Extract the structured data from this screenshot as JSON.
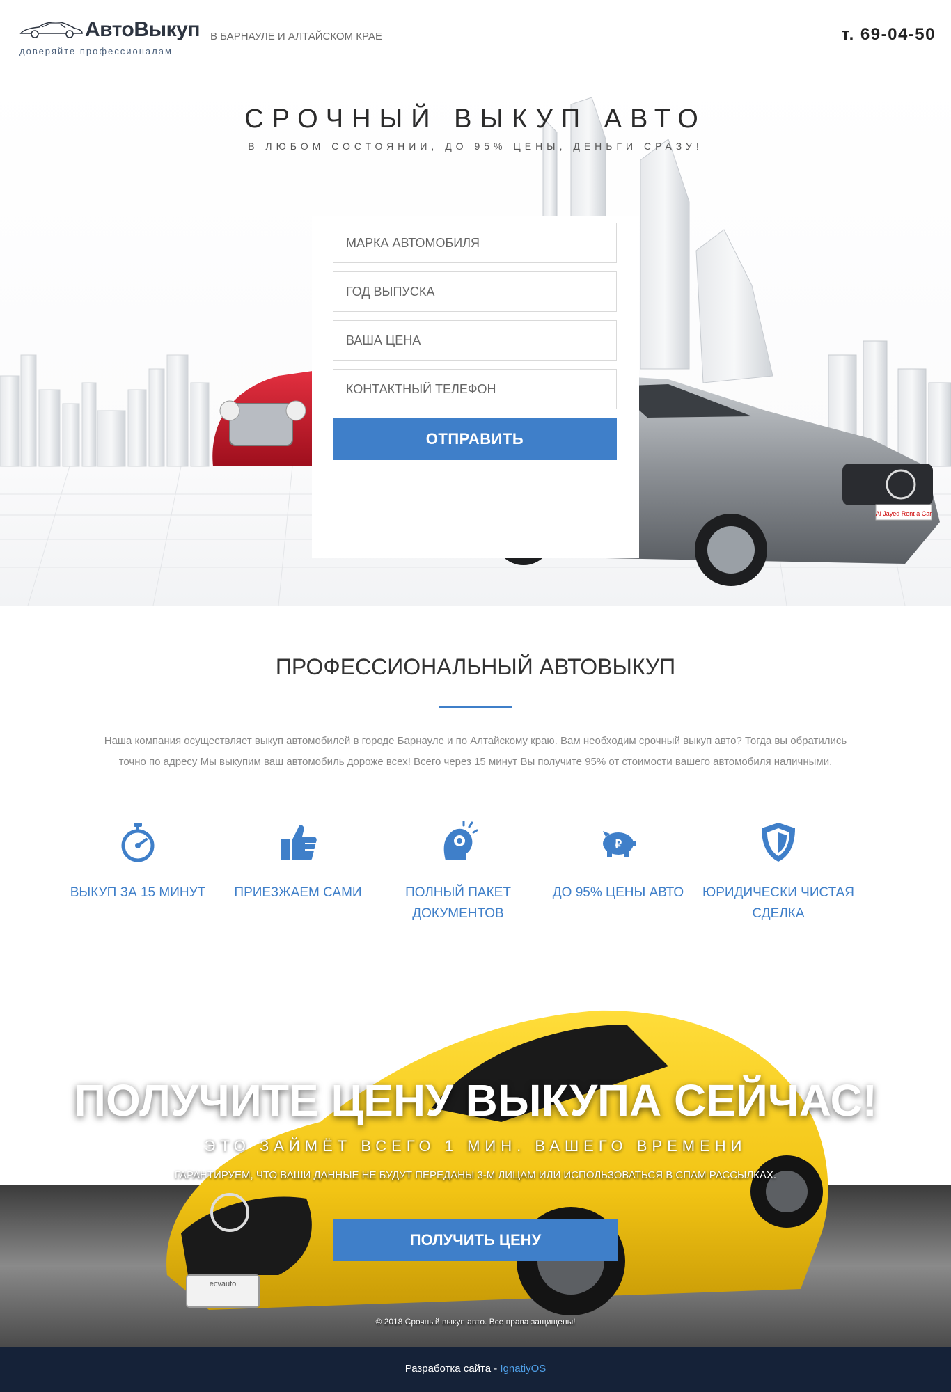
{
  "header": {
    "logo_title": "АвтоВыкуп",
    "logo_tagline": "доверяйте профессионалам",
    "region": "В БАРНАУЛЕ И АЛТАЙСКОМ КРАЕ",
    "phone": "т. 69-04-50"
  },
  "hero": {
    "title": "СРОЧНЫЙ ВЫКУП АВТО",
    "subtitle": "В ЛЮБОМ СОСТОЯНИИ, ДО 95% ЦЕНЫ, ДЕНЬГИ СРАЗУ!",
    "form": {
      "make_placeholder": "МАРКА АВТОМОБИЛЯ",
      "year_placeholder": "ГОД ВЫПУСКА",
      "price_placeholder": "ВАША ЦЕНА",
      "phone_placeholder": "КОНТАКТНЫЙ ТЕЛЕФОН",
      "submit_label": "ОТПРАВИТЬ"
    },
    "plate_text": "Al Jayed Rent a Car"
  },
  "about": {
    "title": "ПРОФЕССИОНАЛЬНЫЙ АВТОВЫКУП",
    "text_line1": "Наша компания осуществляет выкуп автомобилей в городе Барнауле и по Алтайскому краю. Вам необходим срочный выкуп авто? Тогда вы обратились",
    "text_line2": "точно по адресу Мы выкупим ваш автомобиль дороже всех! Всего через 15 минут Вы получите 95% от стоимости вашего автомобиля наличными."
  },
  "features": [
    {
      "icon": "stopwatch-icon",
      "label": "ВЫКУП ЗА 15 МИНУТ"
    },
    {
      "icon": "thumbs-up-icon",
      "label": "ПРИЕЗЖАЕМ САМИ"
    },
    {
      "icon": "documents-icon",
      "label": "ПОЛНЫЙ ПАКЕТ ДОКУМЕНТОВ"
    },
    {
      "icon": "piggy-bank-icon",
      "label": "ДО 95% ЦЕНЫ АВТО"
    },
    {
      "icon": "shield-icon",
      "label": "ЮРИДИЧЕСКИ ЧИСТАЯ СДЕЛКА"
    }
  ],
  "cta": {
    "title": "ПОЛУЧИТЕ ЦЕНУ ВЫКУПА СЕЙЧАС!",
    "subtitle": "ЭТО ЗАЙМЁТ ВСЕГО 1 МИН. ВАШЕГО ВРЕМЕНИ",
    "note": "ГАРАНТИРУЕМ, ЧТО ВАШИ ДАННЫЕ НЕ БУДУТ ПЕРЕДАНЫ 3-М ЛИЦАМ ИЛИ ИСПОЛЬЗОВАТЬСЯ В СПАМ РАССЫЛКАХ.",
    "button_label": "ПОЛУЧИТЬ ЦЕНУ",
    "copyright": "© 2018 Срочный выкуп авто. Все права защищены!",
    "car_plate_text": "ecvauto"
  },
  "footer": {
    "prefix": "Разработка сайта - ",
    "link_text": "IgnatiyOS"
  },
  "colors": {
    "accent": "#3f7fc9",
    "footer_bg": "#152238",
    "car_red": "#c8182a",
    "car_silver": "#9a9ea3",
    "car_yellow": "#f2c414"
  }
}
